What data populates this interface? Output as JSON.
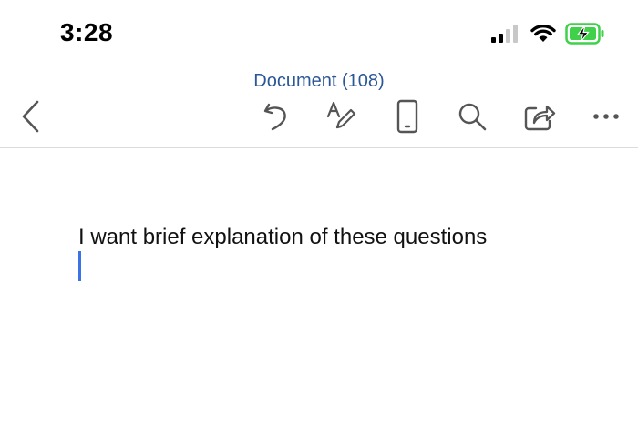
{
  "status_bar": {
    "time": "3:28"
  },
  "header": {
    "document_title": "Document (108)"
  },
  "toolbar": {
    "icons": [
      "back-chevron-icon",
      "undo-icon",
      "draw-pen-icon",
      "mobile-view-icon",
      "search-icon",
      "share-icon",
      "more-options-icon"
    ]
  },
  "document": {
    "text": "I want brief explanation of these questions"
  },
  "colors": {
    "title_blue": "#2b5797",
    "caret_blue": "#3b73e6",
    "battery_green": "#3fd14a"
  }
}
